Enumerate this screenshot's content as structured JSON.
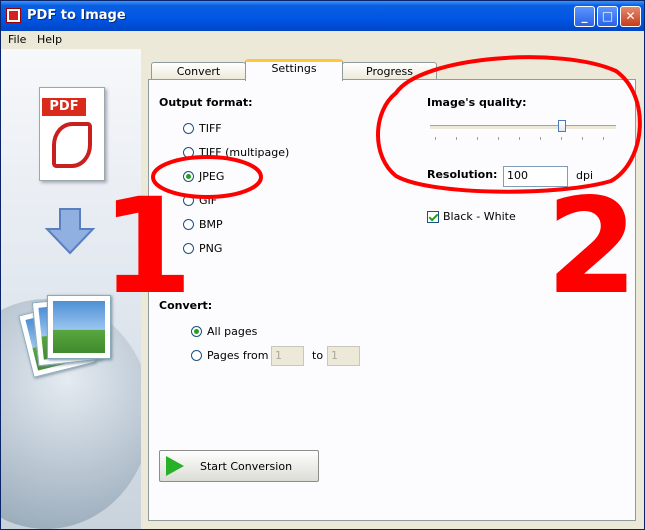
{
  "window": {
    "title": "PDF to Image"
  },
  "menu": [
    "File",
    "Help"
  ],
  "tabs": [
    {
      "label": "Convert",
      "active": false
    },
    {
      "label": "Settings",
      "active": true
    },
    {
      "label": "Progress",
      "active": false
    }
  ],
  "output_format": {
    "label": "Output format:",
    "options": [
      "TIFF",
      "TIFF (multipage)",
      "JPEG",
      "GIF",
      "BMP",
      "PNG"
    ],
    "selected": "JPEG"
  },
  "quality": {
    "label": "Image's quality:",
    "value_fraction": 0.71
  },
  "resolution": {
    "label": "Resolution:",
    "value": "100",
    "unit": "dpi"
  },
  "black_white": {
    "label": "Black - White",
    "checked": true
  },
  "convert": {
    "label": "Convert:",
    "all_pages_label": "All pages",
    "pages_from_label": "Pages from",
    "from_value": "1",
    "to_label": "to",
    "to_value": "1",
    "selected": "All pages"
  },
  "start_button": {
    "label": "Start Conversion"
  },
  "left_panel": {
    "pdf_label": "PDF"
  },
  "annotations": {
    "one": "1",
    "two": "2"
  },
  "colors": {
    "titlebar": "#0055e5",
    "annotation": "#ff0000",
    "radio_check": "#21a121"
  },
  "icons": [
    "app-icon",
    "minimize-icon",
    "maximize-icon",
    "close-icon",
    "pdf-document-icon",
    "down-arrow-icon",
    "images-stack-icon",
    "play-icon"
  ]
}
